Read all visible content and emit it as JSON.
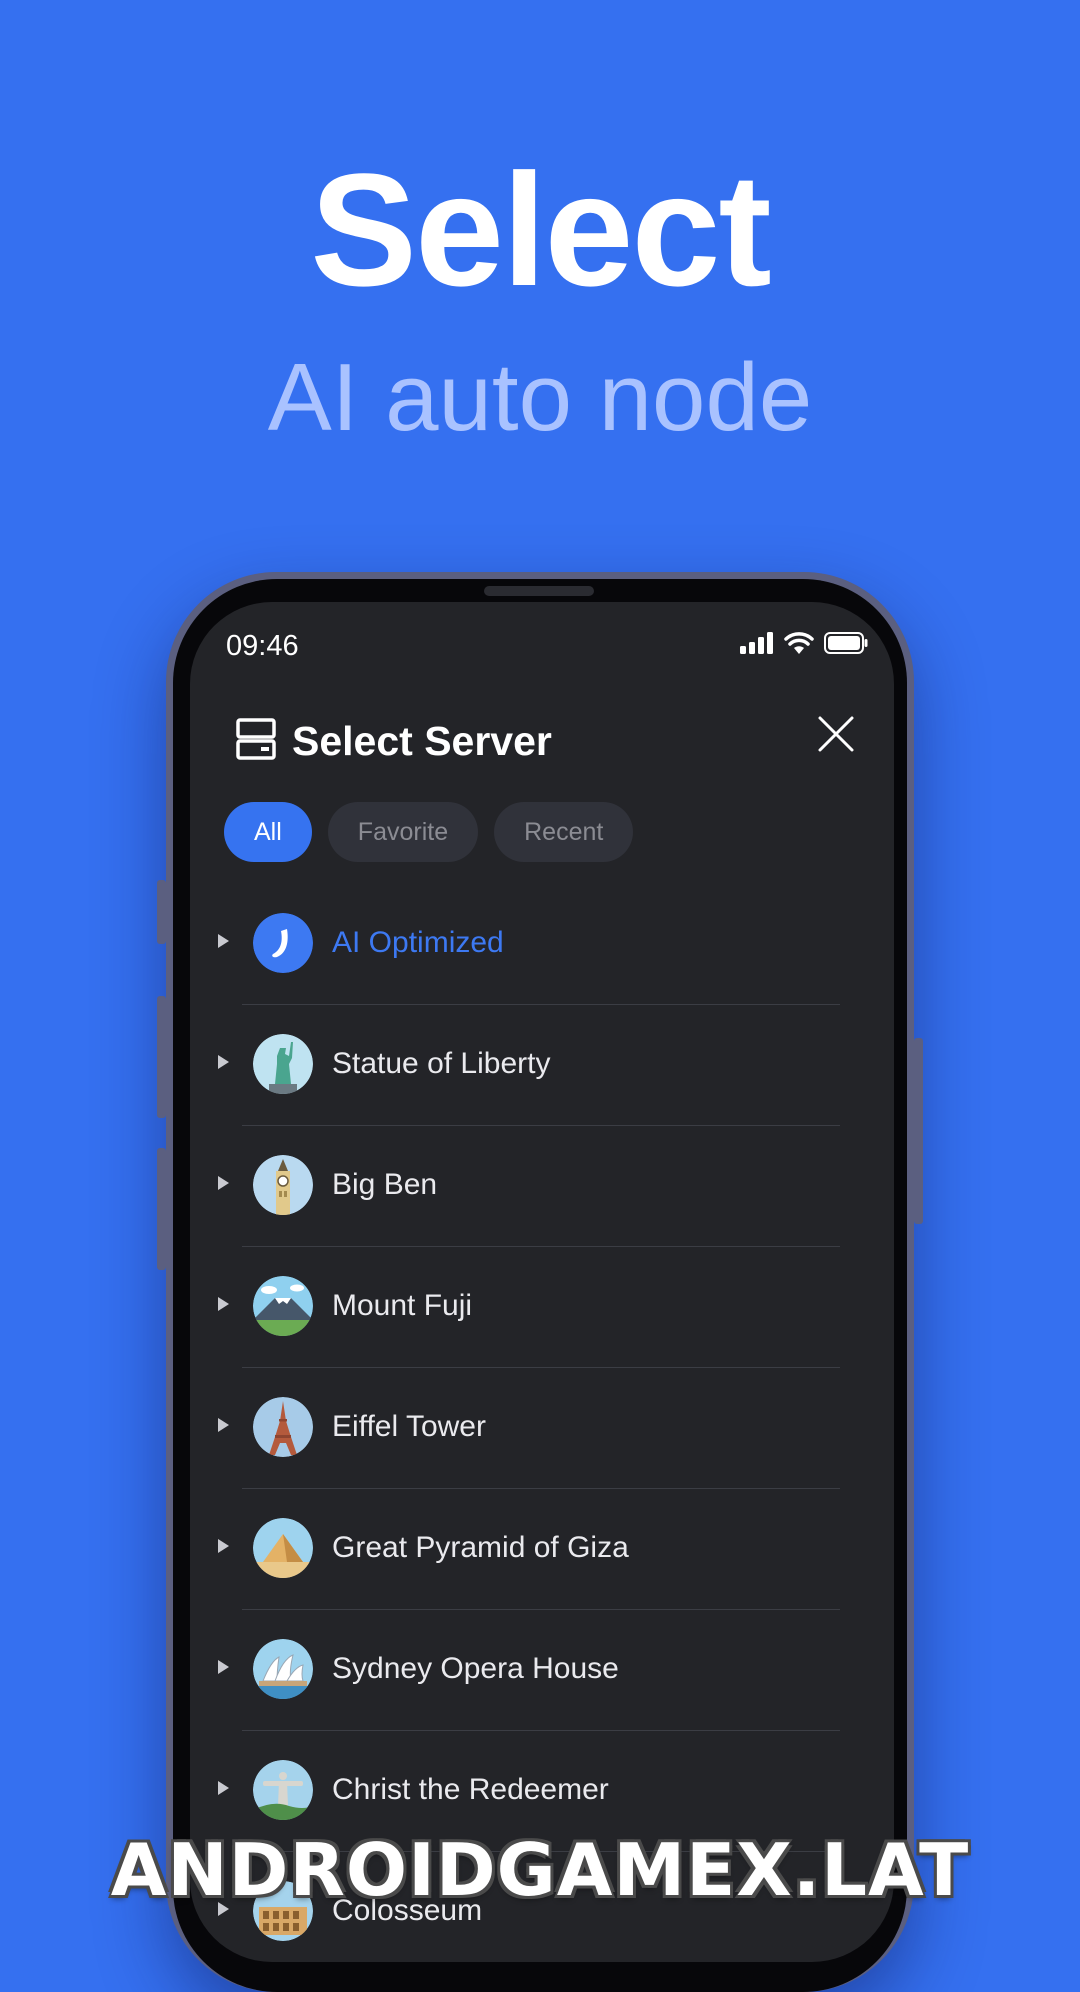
{
  "hero": {
    "title": "Select",
    "subtitle": "AI auto node"
  },
  "status_bar": {
    "time": "09:46"
  },
  "sheet": {
    "title": "Select Server",
    "tabs": [
      {
        "label": "All",
        "active": true
      },
      {
        "label": "Favorite",
        "active": false
      },
      {
        "label": "Recent",
        "active": false
      }
    ],
    "servers": [
      {
        "name": "AI Optimized",
        "icon": "ai-logo-icon",
        "highlight": true
      },
      {
        "name": "Statue of Liberty",
        "icon": "statue-of-liberty-icon"
      },
      {
        "name": "Big Ben",
        "icon": "big-ben-icon"
      },
      {
        "name": "Mount Fuji",
        "icon": "mount-fuji-icon"
      },
      {
        "name": "Eiffel Tower",
        "icon": "eiffel-tower-icon"
      },
      {
        "name": "Great Pyramid of Giza",
        "icon": "pyramid-icon"
      },
      {
        "name": "Sydney Opera House",
        "icon": "opera-house-icon"
      },
      {
        "name": "Christ the Redeemer",
        "icon": "christ-redeemer-icon"
      },
      {
        "name": "Colosseum",
        "icon": "colosseum-icon"
      }
    ]
  },
  "watermark": "ANDROIDGAMEX.LAT",
  "colors": {
    "background": "#3570f0",
    "accent": "#3673f0",
    "sheet": "#232428"
  }
}
